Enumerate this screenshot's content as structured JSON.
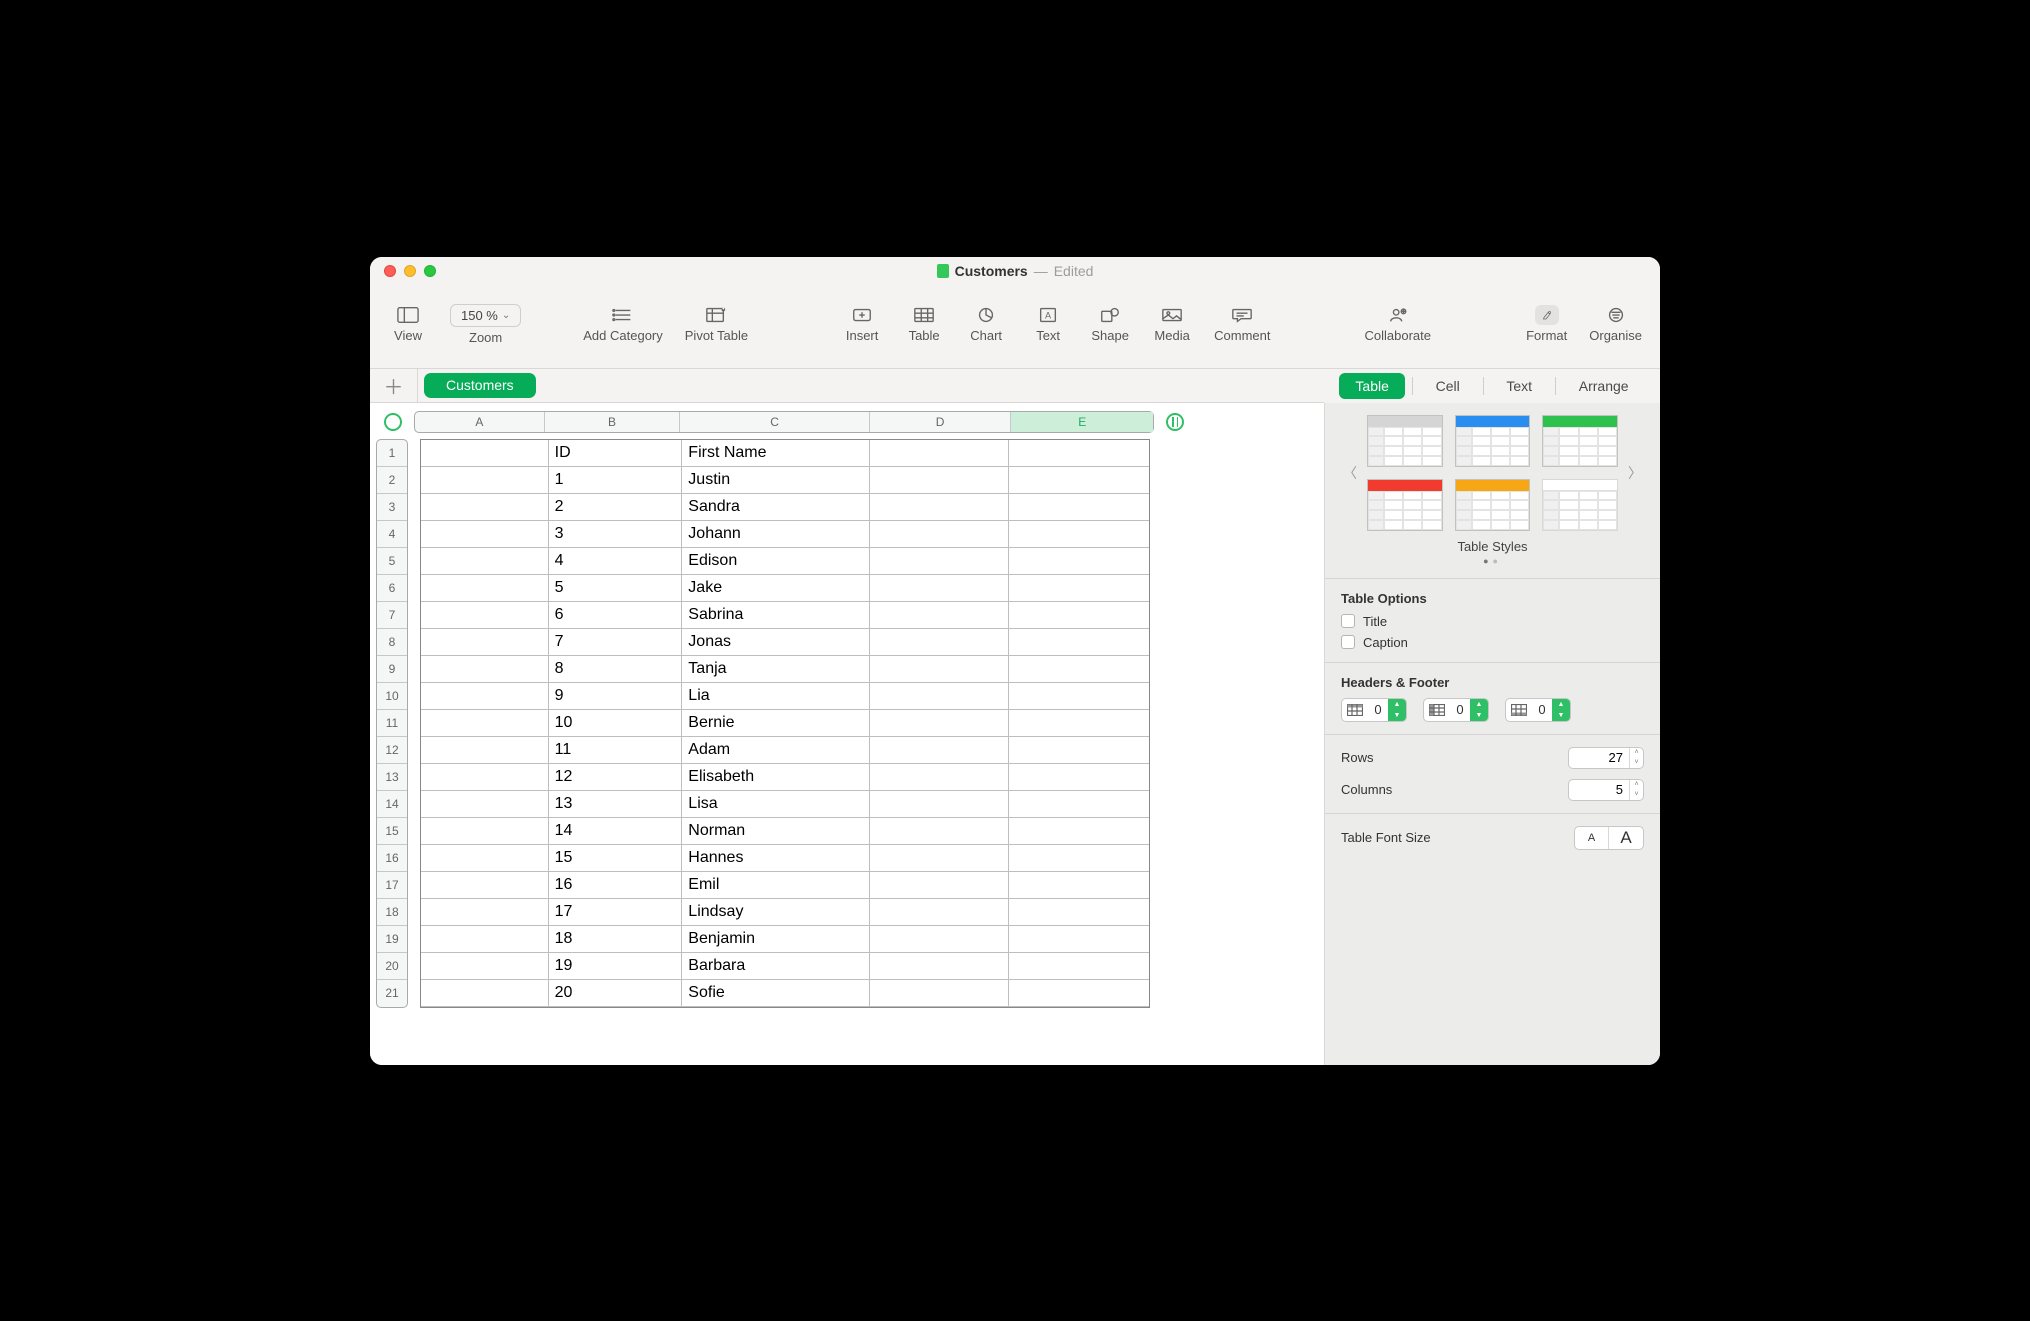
{
  "window": {
    "doc_name": "Customers",
    "edited_label": "Edited"
  },
  "toolbar": {
    "view": "View",
    "zoom_label": "Zoom",
    "zoom_value": "150 %",
    "add_category": "Add Category",
    "pivot_table": "Pivot Table",
    "insert": "Insert",
    "table": "Table",
    "chart": "Chart",
    "text": "Text",
    "shape": "Shape",
    "media": "Media",
    "comment": "Comment",
    "collaborate": "Collaborate",
    "format": "Format",
    "organise": "Organise"
  },
  "sheet": {
    "tab": "Customers"
  },
  "columns": [
    "A",
    "B",
    "C",
    "D",
    "E"
  ],
  "selected_column_index": 4,
  "row_numbers": [
    "1",
    "2",
    "3",
    "4",
    "5",
    "6",
    "7",
    "8",
    "9",
    "10",
    "11",
    "12",
    "13",
    "14",
    "15",
    "16",
    "17",
    "18",
    "19",
    "20",
    "21"
  ],
  "grid": {
    "header": [
      "",
      "ID",
      "First Name",
      "",
      ""
    ],
    "rows": [
      [
        "",
        "1",
        "Justin",
        "",
        ""
      ],
      [
        "",
        "2",
        "Sandra",
        "",
        ""
      ],
      [
        "",
        "3",
        "Johann",
        "",
        ""
      ],
      [
        "",
        "4",
        "Edison",
        "",
        ""
      ],
      [
        "",
        "5",
        "Jake",
        "",
        ""
      ],
      [
        "",
        "6",
        "Sabrina",
        "",
        ""
      ],
      [
        "",
        "7",
        "Jonas",
        "",
        ""
      ],
      [
        "",
        "8",
        "Tanja",
        "",
        ""
      ],
      [
        "",
        "9",
        "Lia",
        "",
        ""
      ],
      [
        "",
        "10",
        "Bernie",
        "",
        ""
      ],
      [
        "",
        "11",
        "Adam",
        "",
        ""
      ],
      [
        "",
        "12",
        "Elisabeth",
        "",
        ""
      ],
      [
        "",
        "13",
        "Lisa",
        "",
        ""
      ],
      [
        "",
        "14",
        "Norman",
        "",
        ""
      ],
      [
        "",
        "15",
        "Hannes",
        "",
        ""
      ],
      [
        "",
        "16",
        "Emil",
        "",
        ""
      ],
      [
        "",
        "17",
        "Lindsay",
        "",
        ""
      ],
      [
        "",
        "18",
        "Benjamin",
        "",
        ""
      ],
      [
        "",
        "19",
        "Barbara",
        "",
        ""
      ],
      [
        "",
        "20",
        "Sofie",
        "",
        ""
      ]
    ]
  },
  "inspector": {
    "tabs": {
      "table": "Table",
      "cell": "Cell",
      "text": "Text",
      "arrange": "Arrange"
    },
    "styles_label": "Table Styles",
    "options_title": "Table Options",
    "opt_title": "Title",
    "opt_caption": "Caption",
    "hf_title": "Headers & Footer",
    "hf_values": [
      "0",
      "0",
      "0"
    ],
    "rows_label": "Rows",
    "rows_value": "27",
    "cols_label": "Columns",
    "cols_value": "5",
    "fontsize_label": "Table Font Size"
  }
}
